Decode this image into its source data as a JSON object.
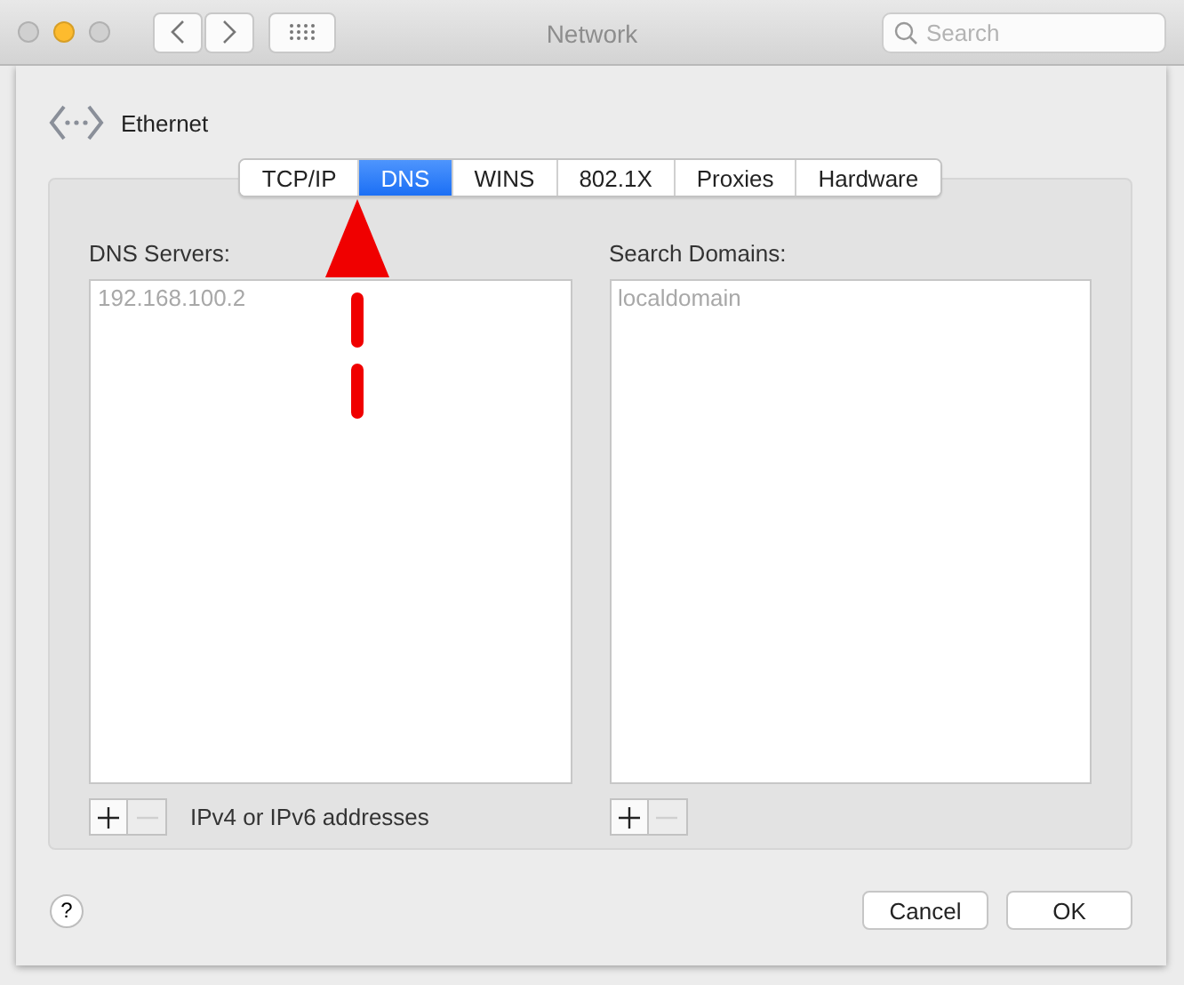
{
  "window": {
    "title": "Network",
    "search": {
      "placeholder": "Search"
    }
  },
  "header": {
    "title": "Ethernet"
  },
  "tabs": [
    {
      "label": "TCP/IP",
      "selected": false
    },
    {
      "label": "DNS",
      "selected": true
    },
    {
      "label": "WINS",
      "selected": false
    },
    {
      "label": "802.1X",
      "selected": false
    },
    {
      "label": "Proxies",
      "selected": false
    },
    {
      "label": "Hardware",
      "selected": false
    }
  ],
  "lists": [
    {
      "label": "DNS Servers:",
      "items": [
        "192.168.100.2"
      ],
      "controls": [
        {
          "kind": "add",
          "disabled": false
        },
        {
          "kind": "remove",
          "disabled": true
        }
      ],
      "hint": "IPv4 or IPv6 addresses"
    },
    {
      "label": "Search Domains:",
      "items": [
        "localdomain"
      ],
      "controls": [
        {
          "kind": "add",
          "disabled": false
        },
        {
          "kind": "remove",
          "disabled": true
        }
      ]
    }
  ],
  "help": {
    "label": "?"
  },
  "buttons": [
    {
      "label": "Cancel"
    },
    {
      "label": "OK"
    }
  ]
}
